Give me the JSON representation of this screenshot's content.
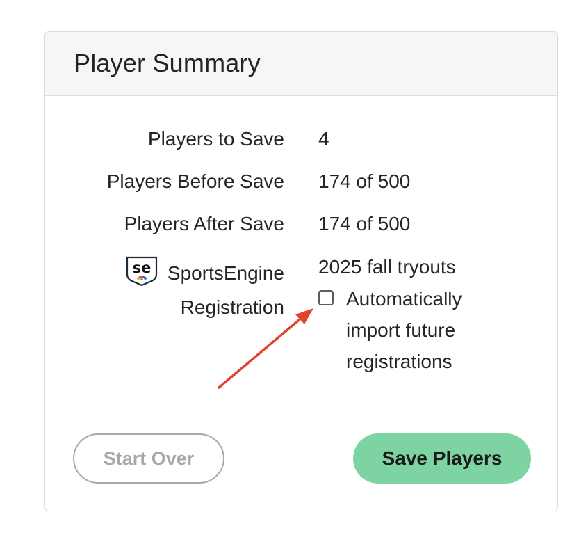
{
  "panel": {
    "title": "Player Summary"
  },
  "summary": {
    "players_to_save_label": "Players to Save",
    "players_to_save_value": "4",
    "players_before_label": "Players Before Save",
    "players_before_value": "174 of 500",
    "players_after_label": "Players After Save",
    "players_after_value": "174 of 500",
    "registration_brand": "SportsEngine",
    "registration_label": "Registration",
    "registration_value": "2025 fall tryouts",
    "auto_import_label": "Automatically import future registrations",
    "auto_import_checked": false
  },
  "buttons": {
    "start_over": "Start Over",
    "save_players": "Save Players"
  },
  "icons": {
    "logo": "sportsengine-logo-icon",
    "annotation": "red-arrow-annotation"
  },
  "colors": {
    "save_button_bg": "#7dd3a1",
    "start_over_border": "#a8a8a8",
    "arrow": "#e0442b",
    "header_bg": "#f6f6f6"
  }
}
